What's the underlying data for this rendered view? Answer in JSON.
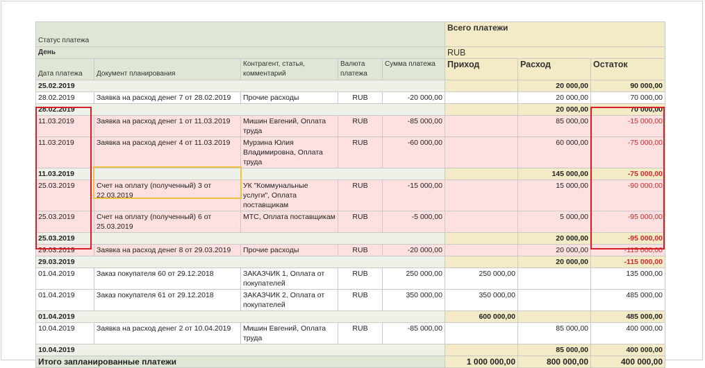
{
  "header": {
    "status_label": "Статус платежа",
    "day_label": "День",
    "total_payments_label": "Всего платежи",
    "currency_header": "RUB",
    "columns": {
      "date": "Дата платежа",
      "document": "Документ планирования",
      "counterparty": "Контрагент, статья, комментарий",
      "currency": "Валюта платежа",
      "amount": "Сумма платежа",
      "income": "Приход",
      "expense": "Расход",
      "balance": "Остаток"
    }
  },
  "rows": [
    {
      "type": "group",
      "date": "25.02.2019",
      "income": "",
      "expense": "20 000,00",
      "balance": "90 000,00",
      "neg": false
    },
    {
      "type": "normal",
      "date": "28.02.2019",
      "document": "Заявка на расход денег 7 от 28.02.2019",
      "counterparty": "Прочие расходы",
      "currency": "RUB",
      "amount": "-20 000,00",
      "income": "",
      "expense": "20 000,00",
      "balance": "70 000,00",
      "neg": false
    },
    {
      "type": "group",
      "date": "28.02.2019",
      "income": "",
      "expense": "20 000,00",
      "balance": "70 000,00",
      "neg": false
    },
    {
      "type": "pink",
      "date": "11.03.2019",
      "document": "Заявка на расход денег 1 от 11.03.2019",
      "counterparty": "Мишин Евгений, Оплата труда",
      "currency": "RUB",
      "amount": "-85 000,00",
      "income": "",
      "expense": "85 000,00",
      "balance": "-15 000,00",
      "neg": true
    },
    {
      "type": "pink",
      "date": "11.03.2019",
      "document": "Заявка на расход денег 4 от 11.03.2019",
      "counterparty": "Мурзина Юлия Владимировна, Оплата труда",
      "currency": "RUB",
      "amount": "-60 000,00",
      "income": "",
      "expense": "60 000,00",
      "balance": "-75 000,00",
      "neg": true
    },
    {
      "type": "group",
      "date": "11.03.2019",
      "income": "",
      "expense": "145 000,00",
      "balance": "-75 000,00",
      "neg": true
    },
    {
      "type": "pink",
      "date": "25.03.2019",
      "document": "Счет на оплату (полученный) 3 от 22.03.2019",
      "counterparty": "УК \"Коммунальные услуги\", Оплата поставщикам",
      "currency": "RUB",
      "amount": "-15 000,00",
      "income": "",
      "expense": "15 000,00",
      "balance": "-90 000,00",
      "neg": true
    },
    {
      "type": "pink",
      "date": "25.03.2019",
      "document": "Счет на оплату (полученный) 6 от 25.03.2019",
      "counterparty": "МТС, Оплата поставщикам",
      "currency": "RUB",
      "amount": "-5 000,00",
      "income": "",
      "expense": "5 000,00",
      "balance": "-95 000,00",
      "neg": true
    },
    {
      "type": "group",
      "date": "25.03.2019",
      "income": "",
      "expense": "20 000,00",
      "balance": "-95 000,00",
      "neg": true
    },
    {
      "type": "pink",
      "date": "29.03.2019",
      "document": "Заявка на расход денег 8 от 29.03.2019",
      "counterparty": "Прочие расходы",
      "currency": "RUB",
      "amount": "-20 000,00",
      "income": "",
      "expense": "20 000,00",
      "balance": "-115 000,00",
      "neg": true
    },
    {
      "type": "group",
      "date": "29.03.2019",
      "income": "",
      "expense": "20 000,00",
      "balance": "-115 000,00",
      "neg": true
    },
    {
      "type": "normal",
      "date": "01.04.2019",
      "document": "Заказ покупателя 60 от 29.12.2018",
      "counterparty": "ЗАКАЗЧИК 1, Оплата от покупателей",
      "currency": "RUB",
      "amount": "250 000,00",
      "income": "250 000,00",
      "expense": "",
      "balance": "135 000,00",
      "neg": false
    },
    {
      "type": "normal",
      "date": "01.04.2019",
      "document": "Заказ покупателя 61 от 29.12.2018",
      "counterparty": "ЗАКАЗЧИК 2, Оплата от покупателей",
      "currency": "RUB",
      "amount": "350 000,00",
      "income": "350 000,00",
      "expense": "",
      "balance": "485 000,00",
      "neg": false
    },
    {
      "type": "group",
      "date": "01.04.2019",
      "income": "600 000,00",
      "expense": "",
      "balance": "485 000,00",
      "neg": false
    },
    {
      "type": "normal",
      "date": "10.04.2019",
      "document": "Заявка на расход денег 2 от 10.04.2019",
      "counterparty": "Мишин Евгений, Оплата труда",
      "currency": "RUB",
      "amount": "-85 000,00",
      "income": "",
      "expense": "85 000,00",
      "balance": "400 000,00",
      "neg": false
    },
    {
      "type": "group",
      "date": "10.04.2019",
      "income": "",
      "expense": "85 000,00",
      "balance": "400 000,00",
      "neg": false
    }
  ],
  "total": {
    "label": "Итого запланированные платежи",
    "income": "1 000 000,00",
    "expense": "800 000,00",
    "balance": "400 000,00"
  },
  "colors": {
    "negative": "#d6262b",
    "highlight_border": "#d81f26",
    "selection_border": "#f0c040",
    "header_green": "#dfe6d5",
    "header_yellow": "#f3ebc6",
    "deficit_row": "#fde0df"
  }
}
